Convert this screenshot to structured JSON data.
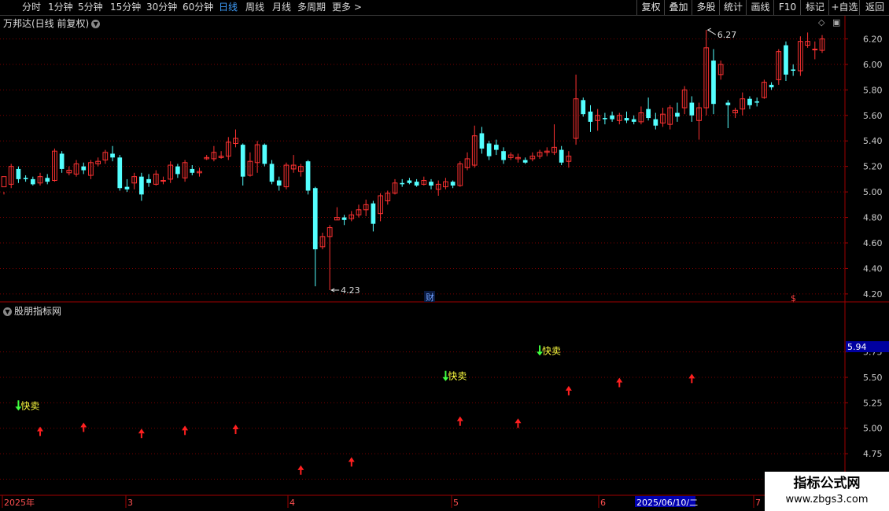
{
  "toolbar": {
    "periods": [
      "分时",
      "1分钟",
      "5分钟",
      "15分钟",
      "30分钟",
      "60分钟",
      "日线",
      "周线",
      "月线",
      "多周期",
      "更多 >"
    ],
    "active_period": "日线",
    "right_buttons": [
      "复权",
      "叠加",
      "多股",
      "统计",
      "画线",
      "F10",
      "标记",
      "+自选",
      "返回"
    ]
  },
  "chart": {
    "title": "万邦达(日线 前复权)",
    "y_ticks": [
      "6.20",
      "6.00",
      "5.80",
      "5.60",
      "5.40",
      "5.20",
      "5.00",
      "4.80",
      "4.60",
      "4.40",
      "4.20"
    ],
    "high_label": "6.27",
    "low_label": "4.23",
    "cai_marker": "财",
    "dollar_marker": "$"
  },
  "indicator": {
    "title": "股朋指标网",
    "y_ticks": [
      "5.75",
      "5.50",
      "5.25",
      "5.00",
      "4.75",
      "4.50"
    ],
    "current_value": "5.94",
    "sell_label": "快卖"
  },
  "xaxis": {
    "labels": [
      "2025年",
      "3",
      "4",
      "5",
      "6",
      "7"
    ],
    "cursor_date": "2025/06/10/二"
  },
  "watermark": {
    "title": "指标公式网",
    "url": "www.zbgs3.com"
  },
  "colors": {
    "up": "#ff3232",
    "down": "#54ffff",
    "grid": "#7a0000",
    "axis": "#a00000",
    "text": "#cccccc",
    "arrow": "#ff2020",
    "sell": "#ffff40",
    "active": "#40a0ff"
  },
  "chart_data": {
    "type": "candlestick",
    "ylim": [
      4.15,
      6.32
    ],
    "candles": [
      [
        5.04,
        5.12,
        5.0,
        4.98
      ],
      [
        5.06,
        5.2,
        5.22,
        5.03
      ],
      [
        5.18,
        5.1,
        5.2,
        5.07
      ],
      [
        5.11,
        5.1,
        5.13,
        5.08
      ],
      [
        5.1,
        5.06,
        5.12,
        5.05
      ],
      [
        5.07,
        5.12,
        5.15,
        5.05
      ],
      [
        5.11,
        5.08,
        5.14,
        5.06
      ],
      [
        5.09,
        5.32,
        5.34,
        5.08
      ],
      [
        5.3,
        5.18,
        5.32,
        5.15
      ],
      [
        5.15,
        5.17,
        5.2,
        5.13
      ],
      [
        5.14,
        5.22,
        5.25,
        5.12
      ],
      [
        5.2,
        5.17,
        5.23,
        5.14
      ],
      [
        5.13,
        5.23,
        5.25,
        5.1
      ],
      [
        5.22,
        5.24,
        5.27,
        5.2
      ],
      [
        5.25,
        5.31,
        5.33,
        5.22
      ],
      [
        5.3,
        5.27,
        5.36,
        5.24
      ],
      [
        5.27,
        5.03,
        5.29,
        5.01
      ],
      [
        5.04,
        5.02,
        5.1,
        5.0
      ],
      [
        5.07,
        5.12,
        5.15,
        5.02
      ],
      [
        5.12,
        4.98,
        5.15,
        4.93
      ],
      [
        5.1,
        5.07,
        5.14,
        5.04
      ],
      [
        5.06,
        5.14,
        5.17,
        5.05
      ],
      [
        5.09,
        5.09,
        5.12,
        5.06
      ],
      [
        5.1,
        5.21,
        5.24,
        5.07
      ],
      [
        5.2,
        5.14,
        5.22,
        5.11
      ],
      [
        5.11,
        5.23,
        5.25,
        5.08
      ],
      [
        5.18,
        5.15,
        5.21,
        5.13
      ],
      [
        5.15,
        5.16,
        5.19,
        5.12
      ],
      [
        5.26,
        5.27,
        5.29,
        5.25
      ],
      [
        5.26,
        5.31,
        5.36,
        5.24
      ],
      [
        5.27,
        5.28,
        5.32,
        5.26
      ],
      [
        5.28,
        5.39,
        5.43,
        5.25
      ],
      [
        5.38,
        5.42,
        5.49,
        5.35
      ],
      [
        5.37,
        5.12,
        5.38,
        5.05
      ],
      [
        5.13,
        5.24,
        5.31,
        5.12
      ],
      [
        5.23,
        5.37,
        5.4,
        5.15
      ],
      [
        5.37,
        5.22,
        5.38,
        5.2
      ],
      [
        5.22,
        5.08,
        5.25,
        5.06
      ],
      [
        5.09,
        5.05,
        5.12,
        5.01
      ],
      [
        5.04,
        5.21,
        5.23,
        5.02
      ],
      [
        5.18,
        5.21,
        5.29,
        5.15
      ],
      [
        5.16,
        5.2,
        5.22,
        5.12
      ],
      [
        5.24,
        5.01,
        5.25,
        4.98
      ],
      [
        5.03,
        4.55,
        5.04,
        4.26
      ],
      [
        4.57,
        4.65,
        4.68,
        4.55
      ],
      [
        4.65,
        4.72,
        4.74,
        4.23
      ],
      [
        4.78,
        4.8,
        4.88,
        4.78
      ],
      [
        4.8,
        4.78,
        4.82,
        4.74
      ],
      [
        4.79,
        4.82,
        4.85,
        4.77
      ],
      [
        4.82,
        4.86,
        4.9,
        4.8
      ],
      [
        4.86,
        4.9,
        4.94,
        4.81
      ],
      [
        4.91,
        4.75,
        4.93,
        4.69
      ],
      [
        4.83,
        4.97,
        4.99,
        4.77
      ],
      [
        4.93,
        4.99,
        5.01,
        4.9
      ],
      [
        4.99,
        5.07,
        5.1,
        4.98
      ],
      [
        5.07,
        5.06,
        5.1,
        5.04
      ],
      [
        5.09,
        5.07,
        5.11,
        5.06
      ],
      [
        5.08,
        5.05,
        5.1,
        5.04
      ],
      [
        5.06,
        5.09,
        5.12,
        5.05
      ],
      [
        5.08,
        5.05,
        5.1,
        5.02
      ],
      [
        5.02,
        5.06,
        5.09,
        4.97
      ],
      [
        5.04,
        5.08,
        5.11,
        5.02
      ],
      [
        5.08,
        5.05,
        5.09,
        5.03
      ],
      [
        5.05,
        5.22,
        5.24,
        5.04
      ],
      [
        5.19,
        5.26,
        5.31,
        5.17
      ],
      [
        5.21,
        5.44,
        5.52,
        5.19
      ],
      [
        5.46,
        5.34,
        5.51,
        5.3
      ],
      [
        5.38,
        5.28,
        5.4,
        5.25
      ],
      [
        5.37,
        5.33,
        5.41,
        5.29
      ],
      [
        5.32,
        5.25,
        5.35,
        5.22
      ],
      [
        5.27,
        5.29,
        5.31,
        5.25
      ],
      [
        5.26,
        5.27,
        5.3,
        5.23
      ],
      [
        5.25,
        5.23,
        5.27,
        5.22
      ],
      [
        5.26,
        5.28,
        5.31,
        5.24
      ],
      [
        5.28,
        5.31,
        5.33,
        5.26
      ],
      [
        5.31,
        5.32,
        5.35,
        5.28
      ],
      [
        5.31,
        5.35,
        5.53,
        5.29
      ],
      [
        5.33,
        5.23,
        5.36,
        5.21
      ],
      [
        5.24,
        5.28,
        5.32,
        5.19
      ],
      [
        5.42,
        5.73,
        5.92,
        5.37
      ],
      [
        5.72,
        5.61,
        5.74,
        5.59
      ],
      [
        5.63,
        5.55,
        5.68,
        5.47
      ],
      [
        5.56,
        5.6,
        5.65,
        5.48
      ],
      [
        5.58,
        5.57,
        5.62,
        5.53
      ],
      [
        5.6,
        5.57,
        5.63,
        5.55
      ],
      [
        5.56,
        5.6,
        5.62,
        5.53
      ],
      [
        5.58,
        5.56,
        5.63,
        5.54
      ],
      [
        5.57,
        5.55,
        5.6,
        5.53
      ],
      [
        5.55,
        5.62,
        5.67,
        5.53
      ],
      [
        5.65,
        5.58,
        5.74,
        5.56
      ],
      [
        5.57,
        5.52,
        5.62,
        5.49
      ],
      [
        5.54,
        5.61,
        5.66,
        5.51
      ],
      [
        5.53,
        5.66,
        5.68,
        5.49
      ],
      [
        5.62,
        5.59,
        5.7,
        5.55
      ],
      [
        5.66,
        5.8,
        5.83,
        5.61
      ],
      [
        5.7,
        5.6,
        5.75,
        5.55
      ],
      [
        5.56,
        5.66,
        5.7,
        5.41
      ],
      [
        5.66,
        6.13,
        6.27,
        5.6
      ],
      [
        6.03,
        5.69,
        6.12,
        5.61
      ],
      [
        5.92,
        6.0,
        6.03,
        5.88
      ],
      [
        5.7,
        5.68,
        5.72,
        5.5
      ],
      [
        5.62,
        5.64,
        5.66,
        5.58
      ],
      [
        5.65,
        5.73,
        5.78,
        5.6
      ],
      [
        5.73,
        5.68,
        5.75,
        5.65
      ],
      [
        5.71,
        5.7,
        5.74,
        5.67
      ],
      [
        5.74,
        5.86,
        5.88,
        5.73
      ],
      [
        5.84,
        5.82,
        5.86,
        5.8
      ],
      [
        5.88,
        6.1,
        6.12,
        5.84
      ],
      [
        6.15,
        5.92,
        6.18,
        5.87
      ],
      [
        5.96,
        5.95,
        6.0,
        5.91
      ],
      [
        5.95,
        6.18,
        6.22,
        5.91
      ],
      [
        6.15,
        6.18,
        6.25,
        6.13
      ],
      [
        6.12,
        6.12,
        6.18,
        6.04
      ],
      [
        6.11,
        6.2,
        6.23,
        6.09
      ]
    ],
    "indicator_arrows": [
      {
        "index": 5,
        "value": 4.97
      },
      {
        "index": 11,
        "value": 5.01
      },
      {
        "index": 19,
        "value": 4.95
      },
      {
        "index": 25,
        "value": 4.98
      },
      {
        "index": 32,
        "value": 4.99
      },
      {
        "index": 41,
        "value": 4.59
      },
      {
        "index": 48,
        "value": 4.67
      },
      {
        "index": 63,
        "value": 5.07
      },
      {
        "index": 71,
        "value": 5.05
      },
      {
        "index": 78,
        "value": 5.37
      },
      {
        "index": 85,
        "value": 5.45
      },
      {
        "index": 95,
        "value": 5.49
      }
    ],
    "sell_signals": [
      {
        "index": 2,
        "value": 5.22
      },
      {
        "index": 61,
        "value": 5.51
      },
      {
        "index": 74,
        "value": 5.76
      }
    ],
    "indicator_ylim": [
      4.38,
      6.18
    ]
  }
}
